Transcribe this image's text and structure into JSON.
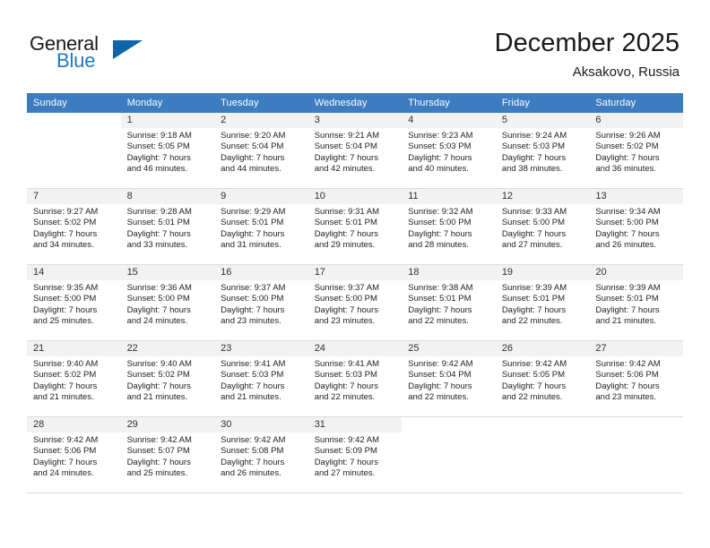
{
  "brand": {
    "name_top": "General",
    "name_bottom": "Blue",
    "flag_color": "#1164a8",
    "blue_color": "#1f78c1"
  },
  "header": {
    "title": "December 2025",
    "location": "Aksakovo, Russia"
  },
  "theme": {
    "header_row_bg": "#3c7cc0",
    "daynum_bg": "#f2f2f2",
    "cell_border": "#dcdcdc"
  },
  "weekdays": [
    "Sunday",
    "Monday",
    "Tuesday",
    "Wednesday",
    "Thursday",
    "Friday",
    "Saturday"
  ],
  "weeks": [
    [
      {
        "day": "",
        "sunrise": "",
        "sunset": "",
        "daylight1": "",
        "daylight2": ""
      },
      {
        "day": "1",
        "sunrise": "Sunrise: 9:18 AM",
        "sunset": "Sunset: 5:05 PM",
        "daylight1": "Daylight: 7 hours",
        "daylight2": "and 46 minutes."
      },
      {
        "day": "2",
        "sunrise": "Sunrise: 9:20 AM",
        "sunset": "Sunset: 5:04 PM",
        "daylight1": "Daylight: 7 hours",
        "daylight2": "and 44 minutes."
      },
      {
        "day": "3",
        "sunrise": "Sunrise: 9:21 AM",
        "sunset": "Sunset: 5:04 PM",
        "daylight1": "Daylight: 7 hours",
        "daylight2": "and 42 minutes."
      },
      {
        "day": "4",
        "sunrise": "Sunrise: 9:23 AM",
        "sunset": "Sunset: 5:03 PM",
        "daylight1": "Daylight: 7 hours",
        "daylight2": "and 40 minutes."
      },
      {
        "day": "5",
        "sunrise": "Sunrise: 9:24 AM",
        "sunset": "Sunset: 5:03 PM",
        "daylight1": "Daylight: 7 hours",
        "daylight2": "and 38 minutes."
      },
      {
        "day": "6",
        "sunrise": "Sunrise: 9:26 AM",
        "sunset": "Sunset: 5:02 PM",
        "daylight1": "Daylight: 7 hours",
        "daylight2": "and 36 minutes."
      }
    ],
    [
      {
        "day": "7",
        "sunrise": "Sunrise: 9:27 AM",
        "sunset": "Sunset: 5:02 PM",
        "daylight1": "Daylight: 7 hours",
        "daylight2": "and 34 minutes."
      },
      {
        "day": "8",
        "sunrise": "Sunrise: 9:28 AM",
        "sunset": "Sunset: 5:01 PM",
        "daylight1": "Daylight: 7 hours",
        "daylight2": "and 33 minutes."
      },
      {
        "day": "9",
        "sunrise": "Sunrise: 9:29 AM",
        "sunset": "Sunset: 5:01 PM",
        "daylight1": "Daylight: 7 hours",
        "daylight2": "and 31 minutes."
      },
      {
        "day": "10",
        "sunrise": "Sunrise: 9:31 AM",
        "sunset": "Sunset: 5:01 PM",
        "daylight1": "Daylight: 7 hours",
        "daylight2": "and 29 minutes."
      },
      {
        "day": "11",
        "sunrise": "Sunrise: 9:32 AM",
        "sunset": "Sunset: 5:00 PM",
        "daylight1": "Daylight: 7 hours",
        "daylight2": "and 28 minutes."
      },
      {
        "day": "12",
        "sunrise": "Sunrise: 9:33 AM",
        "sunset": "Sunset: 5:00 PM",
        "daylight1": "Daylight: 7 hours",
        "daylight2": "and 27 minutes."
      },
      {
        "day": "13",
        "sunrise": "Sunrise: 9:34 AM",
        "sunset": "Sunset: 5:00 PM",
        "daylight1": "Daylight: 7 hours",
        "daylight2": "and 26 minutes."
      }
    ],
    [
      {
        "day": "14",
        "sunrise": "Sunrise: 9:35 AM",
        "sunset": "Sunset: 5:00 PM",
        "daylight1": "Daylight: 7 hours",
        "daylight2": "and 25 minutes."
      },
      {
        "day": "15",
        "sunrise": "Sunrise: 9:36 AM",
        "sunset": "Sunset: 5:00 PM",
        "daylight1": "Daylight: 7 hours",
        "daylight2": "and 24 minutes."
      },
      {
        "day": "16",
        "sunrise": "Sunrise: 9:37 AM",
        "sunset": "Sunset: 5:00 PM",
        "daylight1": "Daylight: 7 hours",
        "daylight2": "and 23 minutes."
      },
      {
        "day": "17",
        "sunrise": "Sunrise: 9:37 AM",
        "sunset": "Sunset: 5:00 PM",
        "daylight1": "Daylight: 7 hours",
        "daylight2": "and 23 minutes."
      },
      {
        "day": "18",
        "sunrise": "Sunrise: 9:38 AM",
        "sunset": "Sunset: 5:01 PM",
        "daylight1": "Daylight: 7 hours",
        "daylight2": "and 22 minutes."
      },
      {
        "day": "19",
        "sunrise": "Sunrise: 9:39 AM",
        "sunset": "Sunset: 5:01 PM",
        "daylight1": "Daylight: 7 hours",
        "daylight2": "and 22 minutes."
      },
      {
        "day": "20",
        "sunrise": "Sunrise: 9:39 AM",
        "sunset": "Sunset: 5:01 PM",
        "daylight1": "Daylight: 7 hours",
        "daylight2": "and 21 minutes."
      }
    ],
    [
      {
        "day": "21",
        "sunrise": "Sunrise: 9:40 AM",
        "sunset": "Sunset: 5:02 PM",
        "daylight1": "Daylight: 7 hours",
        "daylight2": "and 21 minutes."
      },
      {
        "day": "22",
        "sunrise": "Sunrise: 9:40 AM",
        "sunset": "Sunset: 5:02 PM",
        "daylight1": "Daylight: 7 hours",
        "daylight2": "and 21 minutes."
      },
      {
        "day": "23",
        "sunrise": "Sunrise: 9:41 AM",
        "sunset": "Sunset: 5:03 PM",
        "daylight1": "Daylight: 7 hours",
        "daylight2": "and 21 minutes."
      },
      {
        "day": "24",
        "sunrise": "Sunrise: 9:41 AM",
        "sunset": "Sunset: 5:03 PM",
        "daylight1": "Daylight: 7 hours",
        "daylight2": "and 22 minutes."
      },
      {
        "day": "25",
        "sunrise": "Sunrise: 9:42 AM",
        "sunset": "Sunset: 5:04 PM",
        "daylight1": "Daylight: 7 hours",
        "daylight2": "and 22 minutes."
      },
      {
        "day": "26",
        "sunrise": "Sunrise: 9:42 AM",
        "sunset": "Sunset: 5:05 PM",
        "daylight1": "Daylight: 7 hours",
        "daylight2": "and 22 minutes."
      },
      {
        "day": "27",
        "sunrise": "Sunrise: 9:42 AM",
        "sunset": "Sunset: 5:06 PM",
        "daylight1": "Daylight: 7 hours",
        "daylight2": "and 23 minutes."
      }
    ],
    [
      {
        "day": "28",
        "sunrise": "Sunrise: 9:42 AM",
        "sunset": "Sunset: 5:06 PM",
        "daylight1": "Daylight: 7 hours",
        "daylight2": "and 24 minutes."
      },
      {
        "day": "29",
        "sunrise": "Sunrise: 9:42 AM",
        "sunset": "Sunset: 5:07 PM",
        "daylight1": "Daylight: 7 hours",
        "daylight2": "and 25 minutes."
      },
      {
        "day": "30",
        "sunrise": "Sunrise: 9:42 AM",
        "sunset": "Sunset: 5:08 PM",
        "daylight1": "Daylight: 7 hours",
        "daylight2": "and 26 minutes."
      },
      {
        "day": "31",
        "sunrise": "Sunrise: 9:42 AM",
        "sunset": "Sunset: 5:09 PM",
        "daylight1": "Daylight: 7 hours",
        "daylight2": "and 27 minutes."
      },
      {
        "day": "",
        "sunrise": "",
        "sunset": "",
        "daylight1": "",
        "daylight2": ""
      },
      {
        "day": "",
        "sunrise": "",
        "sunset": "",
        "daylight1": "",
        "daylight2": ""
      },
      {
        "day": "",
        "sunrise": "",
        "sunset": "",
        "daylight1": "",
        "daylight2": ""
      }
    ]
  ]
}
